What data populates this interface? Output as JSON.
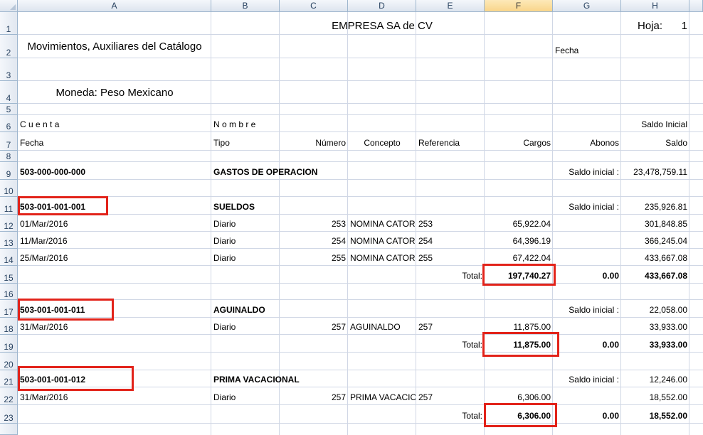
{
  "columns": [
    "A",
    "B",
    "C",
    "D",
    "E",
    "F",
    "G",
    "H"
  ],
  "rows": [
    "1",
    "2",
    "3",
    "4",
    "5",
    "6",
    "7",
    "8",
    "9",
    "10",
    "11",
    "12",
    "13",
    "14",
    "15",
    "16",
    "17",
    "18",
    "19",
    "20",
    "21",
    "22",
    "23"
  ],
  "header": {
    "company": "EMPRESA SA de CV",
    "hoja_label": "Hoja:",
    "hoja_num": "1",
    "report_title": "Movimientos, Auxiliares del Catálogo",
    "fecha_label": "Fecha",
    "moneda": "Moneda: Peso Mexicano"
  },
  "col_titles": {
    "cuenta": "C u e n t a",
    "nombre": "N o m b r e",
    "saldo_inicial": "Saldo Inicial",
    "fecha": "Fecha",
    "tipo": "Tipo",
    "numero": "Número",
    "concepto": "Concepto",
    "referencia": "Referencia",
    "cargos": "Cargos",
    "abonos": "Abonos",
    "saldo": "Saldo"
  },
  "group": {
    "account": "503-000-000-000",
    "name": "GASTOS DE OPERACION",
    "saldo_label": "Saldo inicial :",
    "saldo": "23,478,759.11"
  },
  "accounts": [
    {
      "account": "503-001-001-001",
      "name": "SUELDOS",
      "saldo_label": "Saldo inicial :",
      "saldo": "235,926.81",
      "movements": [
        {
          "fecha": "01/Mar/2016",
          "tipo": "Diario",
          "numero": "253",
          "concepto": "NOMINA CATOR",
          "referencia": "253",
          "cargos": "65,922.04",
          "saldo": "301,848.85"
        },
        {
          "fecha": "11/Mar/2016",
          "tipo": "Diario",
          "numero": "254",
          "concepto": "NOMINA CATOR",
          "referencia": "254",
          "cargos": "64,396.19",
          "saldo": "366,245.04"
        },
        {
          "fecha": "25/Mar/2016",
          "tipo": "Diario",
          "numero": "255",
          "concepto": "NOMINA CATOR",
          "referencia": "255",
          "cargos": "67,422.04",
          "saldo": "433,667.08"
        }
      ],
      "total_label": "Total:",
      "total_cargos": "197,740.27",
      "total_abonos": "0.00",
      "total_saldo": "433,667.08"
    },
    {
      "account": "503-001-001-011",
      "name": "AGUINALDO",
      "saldo_label": "Saldo inicial :",
      "saldo": "22,058.00",
      "movements": [
        {
          "fecha": "31/Mar/2016",
          "tipo": "Diario",
          "numero": "257",
          "concepto": "AGUINALDO",
          "referencia": "257",
          "cargos": "11,875.00",
          "saldo": "33,933.00"
        }
      ],
      "total_label": "Total:",
      "total_cargos": "11,875.00",
      "total_abonos": "0.00",
      "total_saldo": "33,933.00"
    },
    {
      "account": "503-001-001-012",
      "name": "PRIMA VACACIONAL",
      "saldo_label": "Saldo inicial :",
      "saldo": "12,246.00",
      "movements": [
        {
          "fecha": "31/Mar/2016",
          "tipo": "Diario",
          "numero": "257",
          "concepto": "PRIMA VACACIO",
          "referencia": "257",
          "cargos": "6,306.00",
          "saldo": "18,552.00"
        }
      ],
      "total_label": "Total:",
      "total_cargos": "6,306.00",
      "total_abonos": "0.00",
      "total_saldo": "18,552.00"
    }
  ],
  "highlight_color": "#e2231a"
}
